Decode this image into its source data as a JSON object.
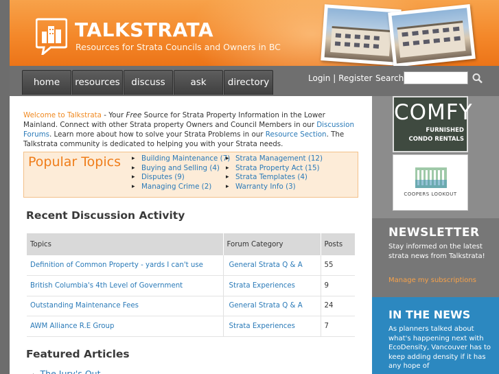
{
  "header": {
    "title": "TALKSTRATA",
    "tagline": "Resources for Strata Councils and Owners in BC"
  },
  "nav": {
    "tabs": [
      {
        "label": "home"
      },
      {
        "label": "resources"
      },
      {
        "label": "discuss"
      },
      {
        "label": "ask"
      },
      {
        "label": "directory"
      }
    ],
    "login": "Login",
    "separator": "|",
    "register": "Register",
    "search_label": "Search"
  },
  "intro": {
    "welcome": "Welcome to Talkstrata",
    "t1": " - Your ",
    "free": "Free",
    "t2": " Source for Strata Property Information in the Lower Mainland. Connect with other Strata property Owners and Council Members in our ",
    "forums_link": "Discussion Forums",
    "t3": ". Learn more about how to solve your Strata Problems in our ",
    "resource_link": "Resource Section",
    "t4": ". The Talkstrata community is dedicated to helping you with your Strata needs."
  },
  "popular": {
    "title": "Popular Topics",
    "col1": [
      "Building Maintenance (7)",
      "Buying and Selling (4)",
      "Disputes (9)",
      "Managing Crime (2)"
    ],
    "col2": [
      "Strata Management (12)",
      "Strata Property Act (15)",
      "Strata Templates (4)",
      "Warranty Info (3)"
    ]
  },
  "recent": {
    "title": "Recent Discussion Activity",
    "headers": [
      "Topics",
      "Forum Category",
      "Posts"
    ],
    "rows": [
      {
        "topic": "Definition of Common Property - yards I can't use",
        "category": "General Strata Q & A",
        "posts": "55"
      },
      {
        "topic": "British Columbia's 4th Level of Government",
        "category": "Strata Experiences",
        "posts": "9"
      },
      {
        "topic": "Outstanding Maintenance Fees",
        "category": "General Strata Q & A",
        "posts": "24"
      },
      {
        "topic": "AWM Alliance R.E Group",
        "category": "Strata Experiences",
        "posts": "7"
      }
    ]
  },
  "featured": {
    "title": "Featured Articles",
    "items": [
      "The Jury's Out"
    ]
  },
  "sidebar": {
    "ad1": {
      "big": "COMFY",
      "line1": "FURNISHED",
      "line2": "CONDO RENTALS"
    },
    "ad2": {
      "label": "COOPERS LOOKOUT"
    },
    "newsletter": {
      "title": "NEWSLETTER",
      "text": "Stay informed on the latest strata news from Talkstrata!",
      "link": "Manage my subscriptions"
    },
    "inthenews": {
      "title": "IN THE NEWS",
      "text": "As planners talked about what's happening next with EcoDensity, Vancouver has to keep adding density if it has any hope of"
    }
  },
  "colors": {
    "orange": "#f4882a",
    "link_blue": "#2a7ab8",
    "news_blue": "#2c88c0"
  }
}
